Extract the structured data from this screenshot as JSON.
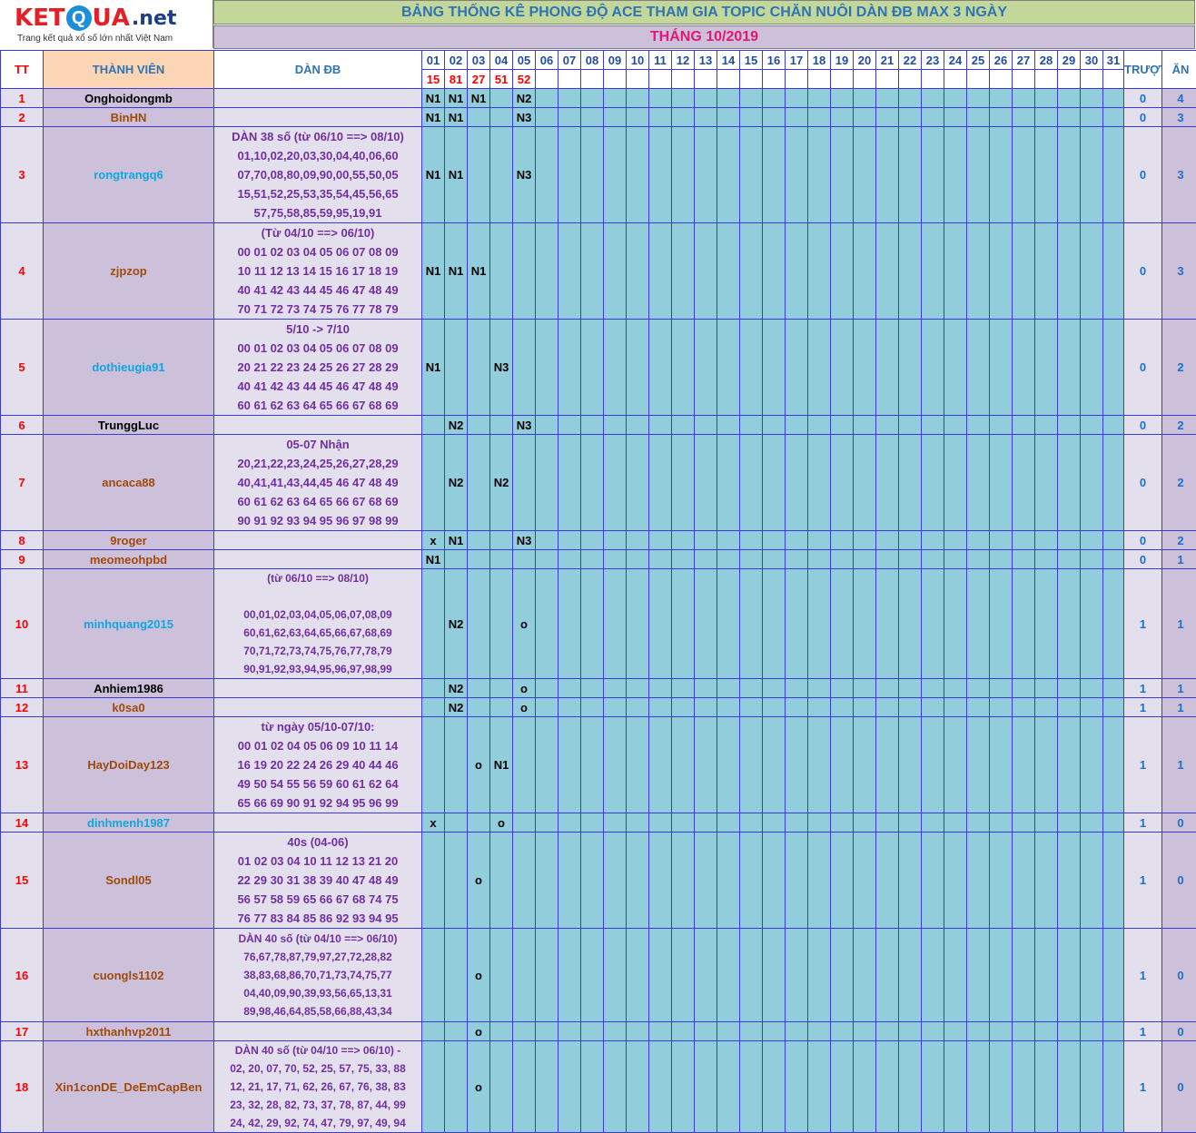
{
  "logo": {
    "letters": [
      "K",
      "E",
      "T",
      "Q",
      "U",
      "A"
    ],
    "suffix": ".net",
    "tagline": "Trang kết quả xổ số lớn nhất Việt Nam"
  },
  "title": "BẢNG THỐNG KÊ PHONG ĐỘ ACE THAM GIA TOPIC CHĂN NUÔI DÀN ĐB MAX 3 NGÀY",
  "month": "THÁNG 10/2019",
  "headers": {
    "tt": "TT",
    "member": "THÀNH VIÊN",
    "dan": "DÀN ĐB",
    "miss": "TRƯỢT",
    "win": "ĂN"
  },
  "days": [
    "01",
    "02",
    "03",
    "04",
    "05",
    "06",
    "07",
    "08",
    "09",
    "10",
    "11",
    "12",
    "13",
    "14",
    "15",
    "16",
    "17",
    "18",
    "19",
    "20",
    "21",
    "22",
    "23",
    "24",
    "25",
    "26",
    "27",
    "28",
    "29",
    "30",
    "31"
  ],
  "results": [
    "15",
    "81",
    "27",
    "51",
    "52"
  ],
  "rows": [
    {
      "tt": "1",
      "member": "Onghoidongmb",
      "color": "black",
      "dan": [],
      "marks": [
        "N1",
        "N1",
        "N1",
        "",
        "N2"
      ],
      "miss": "0",
      "win": "4"
    },
    {
      "tt": "2",
      "member": "BinHN",
      "color": "brown",
      "dan": [],
      "marks": [
        "N1",
        "N1",
        "",
        "",
        "N3"
      ],
      "miss": "0",
      "win": "3"
    },
    {
      "tt": "3",
      "member": "rongtrangq6",
      "color": "blue",
      "dan": [
        "DÀN 38 số (từ 06/10 ==> 08/10)",
        "01,10,02,20,03,30,04,40,06,60",
        "07,70,08,80,09,90,00,55,50,05",
        "15,51,52,25,53,35,54,45,56,65",
        "57,75,58,85,59,95,19,91"
      ],
      "marks": [
        "N1",
        "N1",
        "",
        "",
        "N3"
      ],
      "miss": "0",
      "win": "3"
    },
    {
      "tt": "4",
      "member": "zjpzop",
      "color": "brown",
      "dan": [
        "(Từ 04/10 ==> 06/10)",
        "00 01 02 03 04 05 06 07 08 09",
        "10 11 12 13 14 15 16 17 18 19",
        "40 41 42 43 44 45 46 47 48 49",
        "70 71 72 73 74 75 76 77 78 79"
      ],
      "marks": [
        "N1",
        "N1",
        "N1",
        "",
        ""
      ],
      "miss": "0",
      "win": "3"
    },
    {
      "tt": "5",
      "member": "dothieugia91",
      "color": "blue",
      "dan": [
        "5/10 -> 7/10",
        "00 01 02 03 04 05 06 07 08 09",
        "20 21 22 23 24 25 26 27 28 29",
        "40 41 42 43 44 45 46 47 48 49",
        "60 61 62 63 64 65 66 67 68 69"
      ],
      "marks": [
        "N1",
        "",
        "",
        "N3",
        ""
      ],
      "miss": "0",
      "win": "2"
    },
    {
      "tt": "6",
      "member": "TrunggLuc",
      "color": "black",
      "dan": [],
      "marks": [
        "",
        "N2",
        "",
        "",
        "N3"
      ],
      "miss": "0",
      "win": "2"
    },
    {
      "tt": "7",
      "member": "ancaca88",
      "color": "brown",
      "dan": [
        "05-07 Nhận",
        "20,21,22,23,24,25,26,27,28,29",
        "40,41,41,43,44,45 46 47 48 49",
        "60 61 62 63 64 65 66 67 68 69",
        "90 91 92 93 94 95 96 97 98 99"
      ],
      "marks": [
        "",
        "N2",
        "",
        "N2",
        ""
      ],
      "miss": "0",
      "win": "2"
    },
    {
      "tt": "8",
      "member": "9roger",
      "color": "brown",
      "dan": [],
      "marks": [
        "x",
        "N1",
        "",
        "",
        "N3"
      ],
      "miss": "0",
      "win": "2"
    },
    {
      "tt": "9",
      "member": "meomeohpbd",
      "color": "brown",
      "dan": [],
      "marks": [
        "N1",
        "",
        "",
        "",
        ""
      ],
      "miss": "0",
      "win": "1"
    },
    {
      "tt": "10",
      "member": "minhquang2015",
      "color": "blue",
      "dan": [
        "(từ 06/10 ==> 08/10)",
        "",
        "00,01,02,03,04,05,06,07,08,09",
        "60,61,62,63,64,65,66,67,68,69",
        "70,71,72,73,74,75,76,77,78,79",
        "90,91,92,93,94,95,96,97,98,99"
      ],
      "marks": [
        "",
        "N2",
        "",
        "",
        "o"
      ],
      "miss": "1",
      "win": "1"
    },
    {
      "tt": "11",
      "member": "Anhiem1986",
      "color": "black",
      "dan": [],
      "marks": [
        "",
        "N2",
        "",
        "",
        "o"
      ],
      "miss": "1",
      "win": "1"
    },
    {
      "tt": "12",
      "member": "k0sa0",
      "color": "brown",
      "dan": [],
      "marks": [
        "",
        "N2",
        "",
        "",
        "o"
      ],
      "miss": "1",
      "win": "1"
    },
    {
      "tt": "13",
      "member": "HayDoiDay123",
      "color": "brown",
      "dan": [
        "từ ngày 05/10-07/10:",
        "00 01 02 04 05 06 09 10 11 14",
        "16 19 20 22 24 26 29 40 44 46",
        "49 50 54 55 56 59 60 61 62 64",
        "65 66 69 90 91 92 94 95 96 99"
      ],
      "marks": [
        "",
        "",
        "o",
        "N1",
        ""
      ],
      "miss": "1",
      "win": "1"
    },
    {
      "tt": "14",
      "member": "dinhmenh1987",
      "color": "blue",
      "dan": [],
      "marks": [
        "x",
        "",
        "",
        "o",
        ""
      ],
      "miss": "1",
      "win": "0"
    },
    {
      "tt": "15",
      "member": "Sondl05",
      "color": "brown",
      "dan": [
        "40s (04-06)",
        "01 02 03 04 10 11 12 13 21 20",
        "22 29 30 31 38 39 40 47 48 49",
        "56 57 58 59 65 66 67 68 74 75",
        "76 77 83 84 85 86 92 93 94 95"
      ],
      "marks": [
        "",
        "",
        "o",
        "",
        ""
      ],
      "miss": "1",
      "win": "0"
    },
    {
      "tt": "16",
      "member": "cuongls1102",
      "color": "brown",
      "dan": [
        "DÀN 40 số (từ 04/10 ==> 06/10)",
        "76,67,78,87,79,97,27,72,28,82",
        "38,83,68,86,70,71,73,74,75,77",
        "04,40,09,90,39,93,56,65,13,31",
        "89,98,46,64,85,58,66,88,43,34"
      ],
      "marks": [
        "",
        "",
        "o",
        "",
        ""
      ],
      "miss": "1",
      "win": "0"
    },
    {
      "tt": "17",
      "member": "hxthanhvp2011",
      "color": "brown",
      "dan": [],
      "marks": [
        "",
        "",
        "o",
        "",
        ""
      ],
      "miss": "1",
      "win": "0"
    },
    {
      "tt": "18",
      "member": "Xin1conDE_DeEmCapBen",
      "color": "brown",
      "dan": [
        "DÀN 40 số (từ 04/10 ==> 06/10) -",
        "02, 20, 07, 70, 52, 25, 57, 75, 33, 88",
        "12, 21, 17, 71, 62, 26, 67, 76, 38, 83",
        "23, 32, 28, 82, 73, 37, 78, 87, 44, 99",
        "24, 42, 29, 92, 74, 47, 79, 97, 49, 94"
      ],
      "marks": [
        "",
        "",
        "o",
        "",
        ""
      ],
      "miss": "1",
      "win": "0"
    }
  ],
  "colors": {
    "green_bar": "#c4d79b",
    "purple_bar": "#ccc0da",
    "light_purple": "#e4dfec",
    "teal": "#92cddc",
    "peach": "#fcd5b4",
    "grid": "#3b3bdc",
    "red": "#ff0000",
    "blue": "#2e74b5"
  }
}
